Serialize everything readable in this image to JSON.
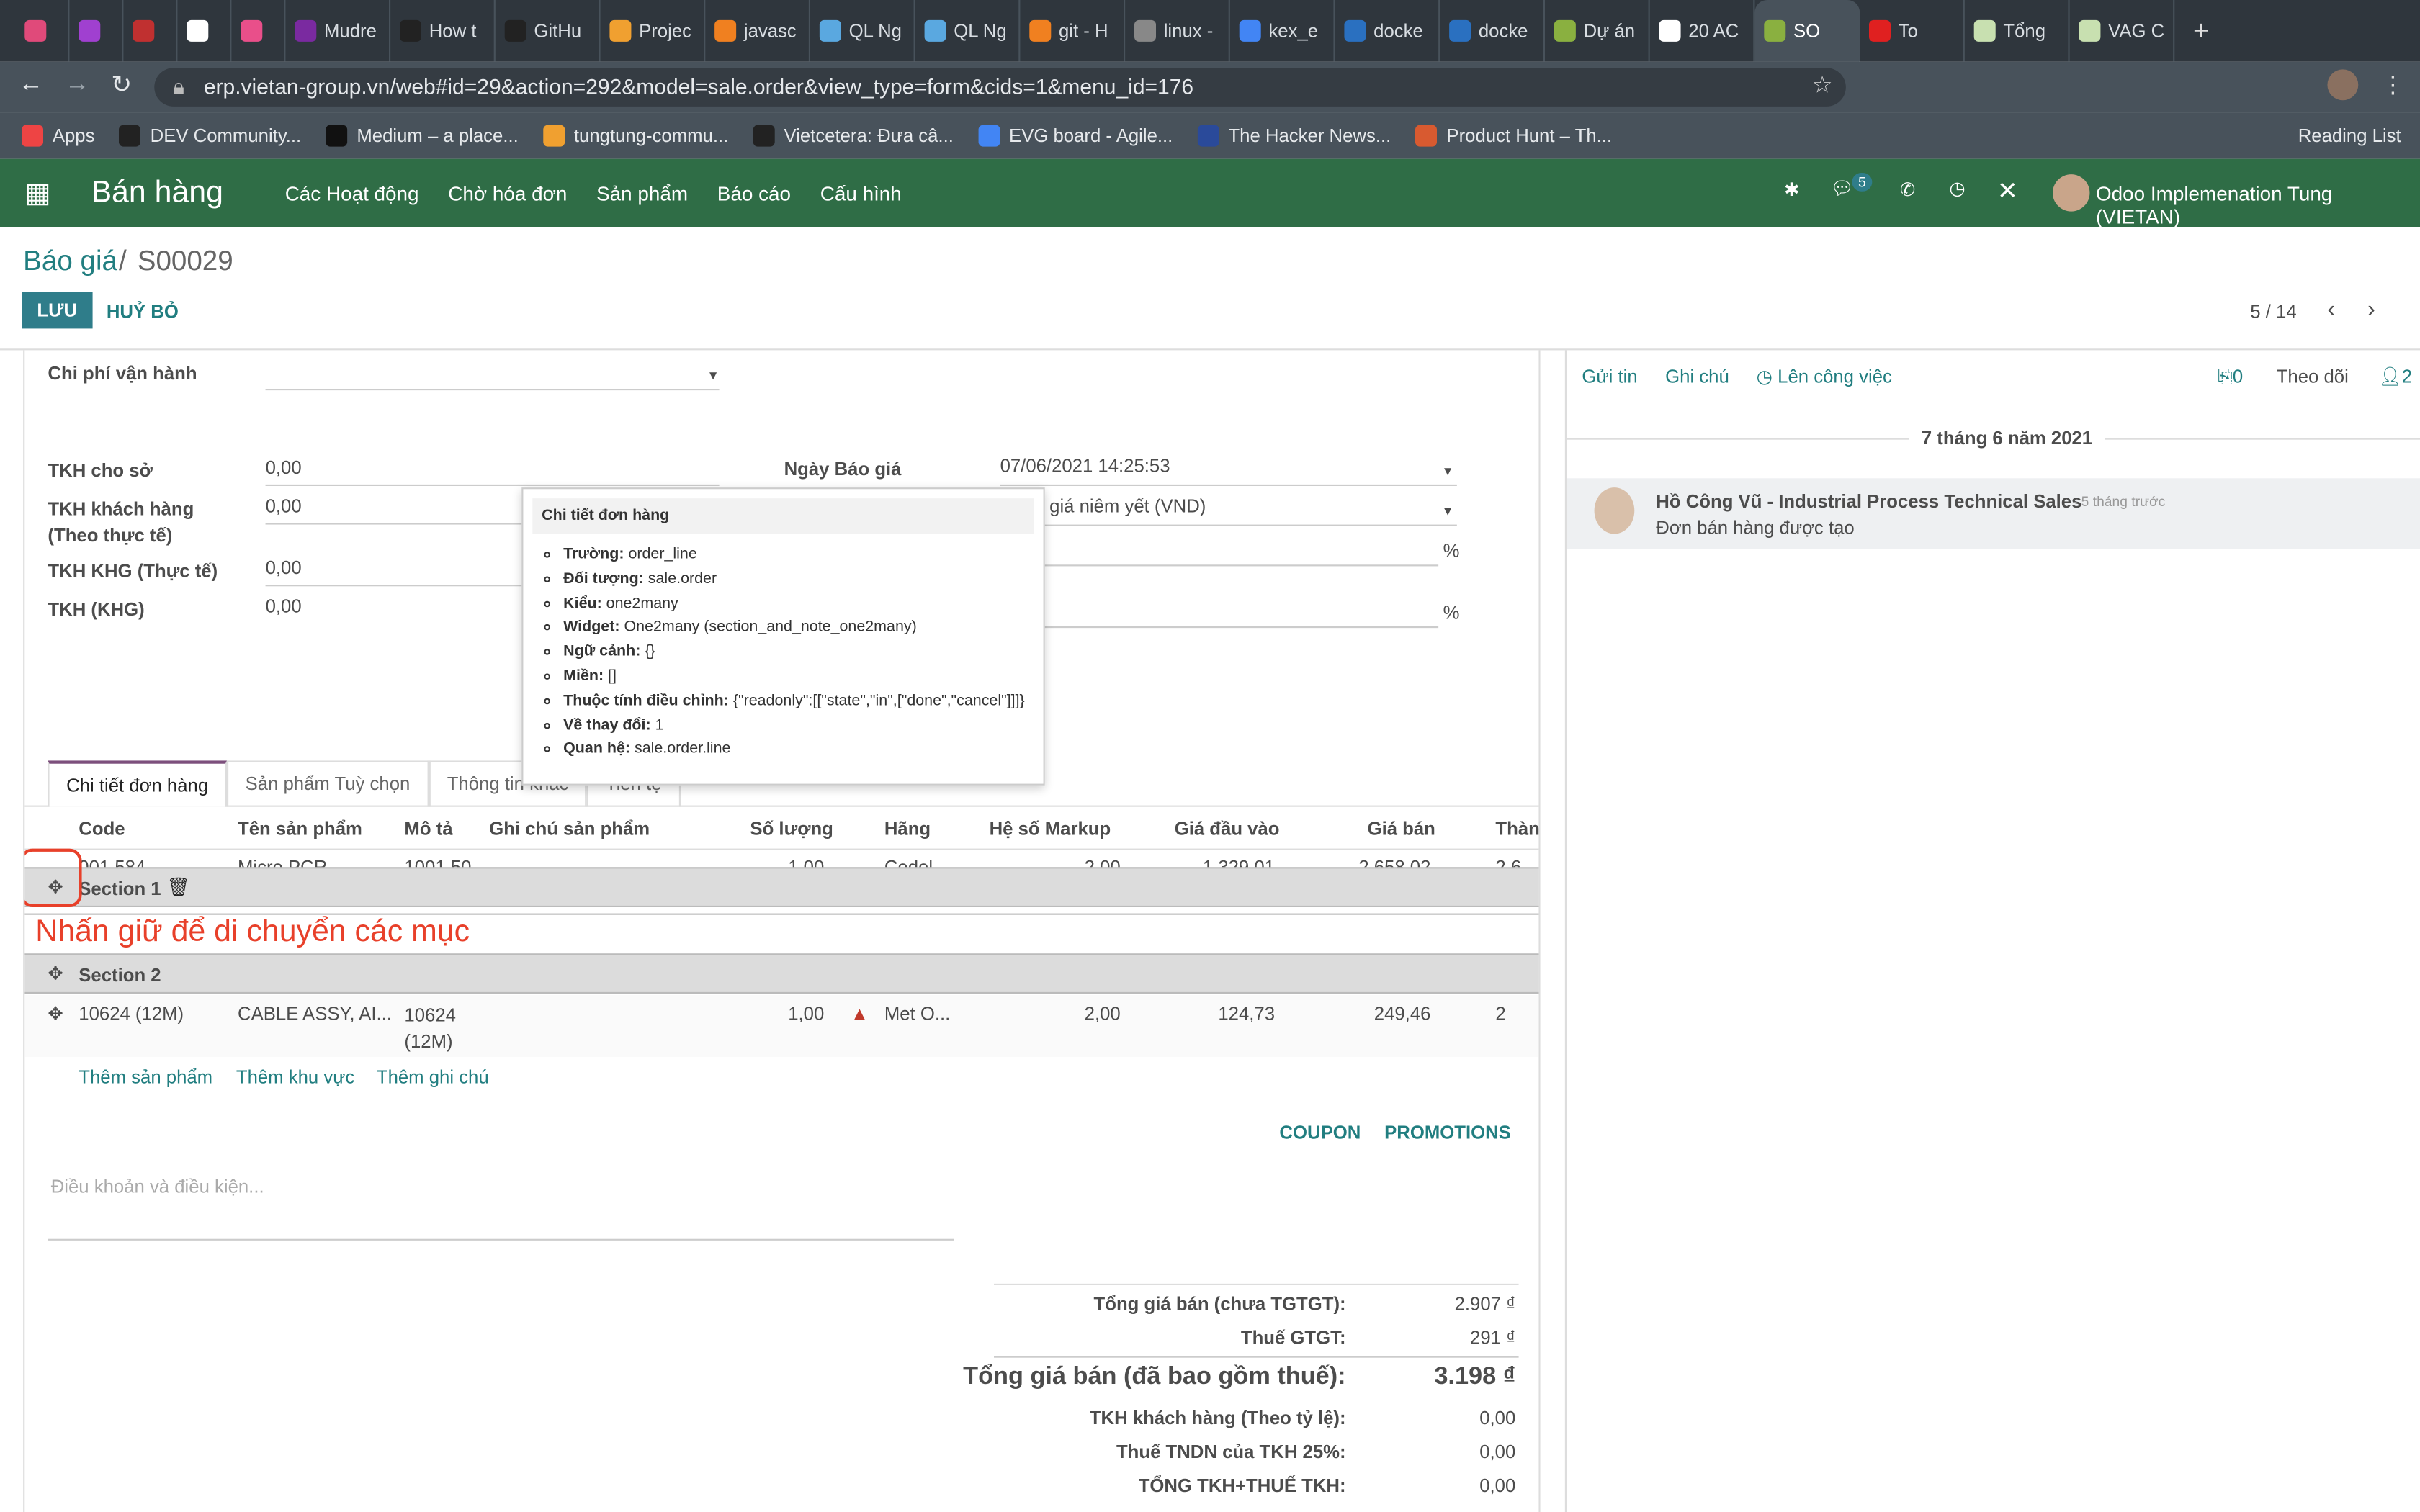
{
  "browser": {
    "tabs": [
      {
        "label": "",
        "color": "#e04a7a"
      },
      {
        "label": "",
        "color": "#a040d0"
      },
      {
        "label": "",
        "color": "#c03030"
      },
      {
        "label": "",
        "color": "#ffffff"
      },
      {
        "label": "",
        "color": "#e94f8a"
      },
      {
        "label": "Mudre",
        "color": "#7a2aa0"
      },
      {
        "label": "How t",
        "color": "#222"
      },
      {
        "label": "GitHu",
        "color": "#222"
      },
      {
        "label": "Projec",
        "color": "#f0a030"
      },
      {
        "label": "javasc",
        "color": "#f08020"
      },
      {
        "label": "QL Ng",
        "color": "#5aa8e0"
      },
      {
        "label": "QL Ng",
        "color": "#5aa8e0"
      },
      {
        "label": "git - H",
        "color": "#f08020"
      },
      {
        "label": "linux -",
        "color": "#888"
      },
      {
        "label": "kex_e",
        "color": "#4285f4"
      },
      {
        "label": "docke",
        "color": "#2a70c0"
      },
      {
        "label": "docke",
        "color": "#2a70c0"
      },
      {
        "label": "Dự án",
        "color": "#8ab040"
      },
      {
        "label": "20 AC",
        "color": "#ffffff"
      },
      {
        "label": "SO",
        "color": "#8ab040",
        "active": true
      },
      {
        "label": "To",
        "color": "#e02020"
      },
      {
        "label": "Tổng",
        "color": "#c8e0b0"
      },
      {
        "label": "VAG C",
        "color": "#c8e0b0"
      }
    ],
    "url": "erp.vietan-group.vn/web#id=29&action=292&model=sale.order&view_type=form&cids=1&menu_id=176",
    "bookmarks": [
      "Apps",
      "DEV Community...",
      "Medium – a place...",
      "tungtung-commu...",
      "Vietcetera: Đưa câ...",
      "EVG board - Agile...",
      "The Hacker News...",
      "Product Hunt – Th..."
    ],
    "reading_list": "Reading List"
  },
  "nav": {
    "brand": "Bán hàng",
    "menus": [
      "Các Hoạt động",
      "Chờ hóa đơn",
      "Sản phẩm",
      "Báo cáo",
      "Cấu hình"
    ],
    "messages_badge": "5",
    "user": "Odoo Implemenation Tung (VIETAN)",
    "color": "#2f6d46"
  },
  "breadcrumb": {
    "parent": "Báo giá",
    "current": "S00029"
  },
  "actions": {
    "save": "LƯU",
    "discard": "HUỶ BỎ",
    "pager": "5 / 14"
  },
  "form": {
    "chi_phi_label": "Chi phí vận hành",
    "fields_left": [
      {
        "label": "TKH cho sở",
        "value": "0,00"
      },
      {
        "label": "TKH khách hàng (Theo thực tế)",
        "value": "0,00"
      },
      {
        "label": "TKH KHG (Thực tế)",
        "value": "0,00"
      },
      {
        "label": "TKH (KHG)",
        "value": "0,00"
      }
    ],
    "ngay_bao_gia_label": "Ngày Báo giá",
    "ngay_bao_gia": "07/06/2021 14:25:53",
    "pricelist": "giá niêm yết (VND)",
    "percent": "%"
  },
  "tooltip": {
    "title": "Chi tiết đơn hàng",
    "items": [
      {
        "k": "Trường:",
        "v": "order_line"
      },
      {
        "k": "Đối tượng:",
        "v": "sale.order"
      },
      {
        "k": "Kiểu:",
        "v": "one2many"
      },
      {
        "k": "Widget:",
        "v": "One2many (section_and_note_one2many)"
      },
      {
        "k": "Ngữ cảnh:",
        "v": "{}"
      },
      {
        "k": "Miền:",
        "v": "[]"
      },
      {
        "k": "Thuộc tính điều chỉnh:",
        "v": "{\"readonly\":[[\"state\",\"in\",[\"done\",\"cancel\"]]]}"
      },
      {
        "k": "Về thay đổi:",
        "v": "1"
      },
      {
        "k": "Quan hệ:",
        "v": "sale.order.line"
      }
    ]
  },
  "notebook": {
    "tabs": [
      "Chi tiết đơn hàng",
      "Sản phẩm Tuỳ chọn",
      "Thông tin khác",
      "Tiền tệ"
    ]
  },
  "table": {
    "headers": [
      "Code",
      "Tên sản phẩm",
      "Mô tả",
      "Ghi chú sản phẩm",
      "Số lượng",
      "Hãng",
      "Hệ số Markup",
      "Giá đầu vào",
      "Giá bán",
      "Thành"
    ],
    "partial_row": [
      "001.584",
      "Micro PCR",
      "1001.50",
      "",
      "1,00",
      "Cedel",
      "2,00",
      "1.329,01",
      "2.658,02",
      "2.6"
    ],
    "section1": "Section 1",
    "section2": "Section 2",
    "row": [
      "10624 (12M)",
      "CABLE ASSY, AI...",
      "10624 (12M)",
      "",
      "1,00",
      "Met O...",
      "2,00",
      "124,73",
      "249,46",
      "2"
    ],
    "add": [
      "Thêm sản phẩm",
      "Thêm khu vực",
      "Thêm ghi chú"
    ]
  },
  "annotation": "Nhấn giữ để di chuyển các mục",
  "coupon": "COUPON",
  "promotions": "PROMOTIONS",
  "terms_placeholder": "Điều khoản và điều kiện...",
  "totals": [
    {
      "k": "Tổng giá bán (chưa TGTGT):",
      "v": "2.907 ₫"
    },
    {
      "k": "Thuế GTGT:",
      "v": "291 ₫"
    },
    {
      "k": "Tổng giá bán (đã bao gồm thuế):",
      "v": "3.198 ₫",
      "big": true
    },
    {
      "k": "TKH khách hàng (Theo tỷ lệ):",
      "v": "0,00"
    },
    {
      "k": "Thuế TNDN của TKH 25%:",
      "v": "0,00"
    },
    {
      "k": "TỔNG TKH+THUẾ TKH:",
      "v": "0,00"
    }
  ],
  "chatter": {
    "send": "Gửi tin",
    "note": "Ghi chú",
    "activity": "Lên công việc",
    "attachments": "0",
    "follow": "Theo dõi",
    "followers": "2",
    "date": "7 tháng 6 năm 2021",
    "author": "Hồ Công Vũ - Industrial Process Technical Sales",
    "time": "- 5 tháng trước",
    "body": "Đơn bán hàng được tạo"
  }
}
